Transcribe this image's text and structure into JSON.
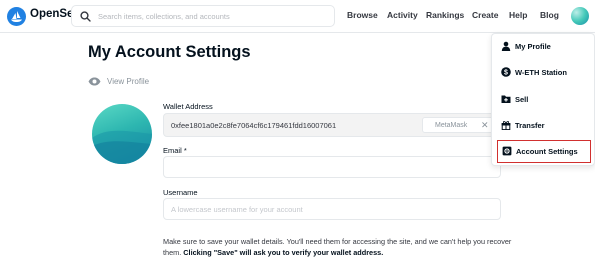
{
  "header": {
    "brand": "OpenSea",
    "search": {
      "placeholder": "Search items, collections, and accounts",
      "value": ""
    },
    "nav": [
      "Browse",
      "Activity",
      "Rankings",
      "Create",
      "Help",
      "Blog"
    ]
  },
  "main": {
    "title": "My Account Settings",
    "view_profile": "View Profile",
    "wallet": {
      "label": "Wallet Address",
      "value": "0xfee1801a0e2c8fe7064cf6c179461fdd16007061",
      "provider": "MetaMask"
    },
    "email": {
      "label": "Email *",
      "value": "",
      "placeholder": ""
    },
    "username": {
      "label": "Username",
      "value": "",
      "placeholder": "A lowercase username for your account"
    },
    "notice": {
      "text": "Make sure to save your wallet details. You'll need them for accessing the site, and we can't help you recover them.",
      "bold": "Clicking \"Save\" will ask you to verify your wallet address."
    }
  },
  "dropdown": {
    "items": [
      {
        "label": "My Profile",
        "icon": "person-icon"
      },
      {
        "label": "W-ETH Station",
        "icon": "dollar-coin-icon"
      },
      {
        "label": "Sell",
        "icon": "folder-add-icon"
      },
      {
        "label": "Transfer",
        "icon": "gift-icon"
      },
      {
        "label": "Account Settings",
        "icon": "settings-icon",
        "highlighted": true
      }
    ],
    "highlight_color": "#d1302f"
  },
  "colors": {
    "brand_blue": "#2081e2",
    "avatar_teal": "#2db6b0"
  }
}
